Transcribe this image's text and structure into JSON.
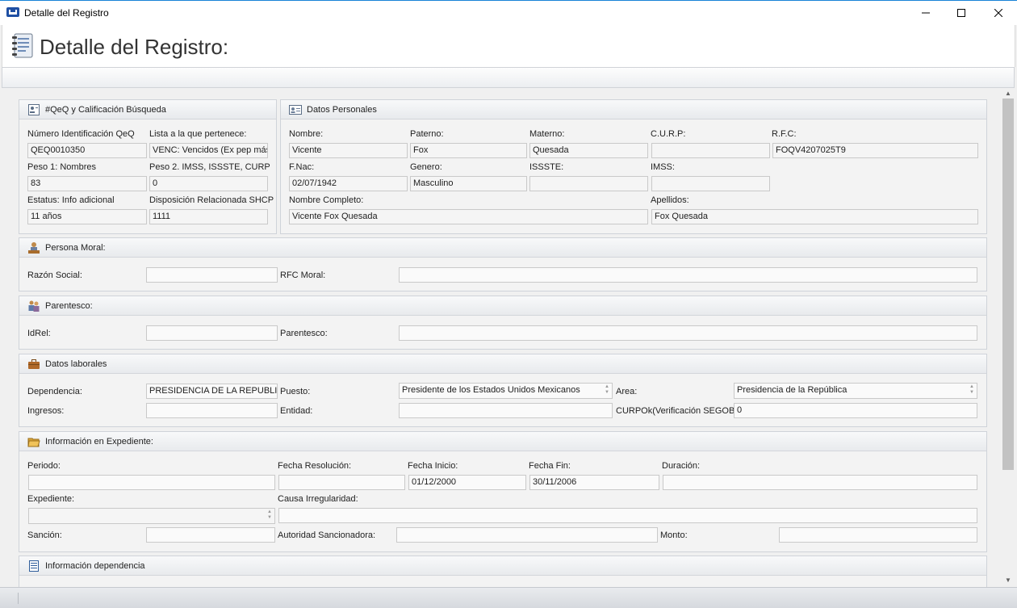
{
  "window": {
    "title": "Detalle del Registro",
    "minimize_icon": "minimize-icon",
    "maximize_icon": "maximize-icon",
    "close_icon": "close-icon"
  },
  "header": {
    "title": "Detalle del Registro:",
    "icon": "notebook-icon"
  },
  "qeq": {
    "title": "#QeQ y Calificación Búsqueda",
    "numero_label": "Número Identificación QeQ",
    "numero": "QEQ0010350",
    "lista_label": "Lista a la que pertenece:",
    "lista": "VENC: Vencidos (Ex pep más",
    "peso1_label": "Peso 1: Nombres",
    "peso1": "83",
    "peso2_label": "Peso 2. IMSS, ISSSTE, CURP",
    "peso2": "0",
    "estatus_label": "Estatus: Info adicional",
    "estatus": "11 años",
    "disposicion_label": "Disposición Relacionada SHCP",
    "disposicion": "1111"
  },
  "personales": {
    "title": "Datos Personales",
    "nombre_label": "Nombre:",
    "nombre": "Vicente",
    "paterno_label": "Paterno:",
    "paterno": "Fox",
    "materno_label": "Materno:",
    "materno": "Quesada",
    "curp_label": "C.U.R.P:",
    "curp": "",
    "rfc_label": "R.F.C:",
    "rfc": "FOQV4207025T9",
    "fnac_label": "F.Nac:",
    "fnac": "02/07/1942",
    "genero_label": "Genero:",
    "genero": "Masculino",
    "issste_label": "ISSSTE:",
    "issste": "",
    "imss_label": "IMSS:",
    "imss": "",
    "completo_label": "Nombre Completo:",
    "completo": "Vicente Fox Quesada",
    "apellidos_label": "Apellidos:",
    "apellidos": "Fox Quesada"
  },
  "moral": {
    "title": "Persona Moral:",
    "razon_label": "Razón Social:",
    "razon": "",
    "rfc_label": "RFC Moral:",
    "rfc": ""
  },
  "parentesco": {
    "title": "Parentesco:",
    "idrel_label": "IdRel:",
    "idrel": "",
    "par_label": "Parentesco:",
    "par": ""
  },
  "laborales": {
    "title": "Datos laborales",
    "dependencia_label": "Dependencia:",
    "dependencia": "PRESIDENCIA DE LA REPUBLICA",
    "puesto_label": "Puesto:",
    "puesto": "Presidente de los Estados Unidos Mexicanos",
    "area_label": "Area:",
    "area": "Presidencia de la República",
    "ingresos_label": "Ingresos:",
    "ingresos": "",
    "entidad_label": "Entidad:",
    "entidad": "",
    "curpok_label": "CURPOk(Verificación SEGOB):",
    "curpok": "0"
  },
  "expediente": {
    "title": "Información en Expediente:",
    "periodo_label": "Periodo:",
    "periodo": "",
    "fres_label": "Fecha Resolución:",
    "fres": "",
    "finicio_label": "Fecha Inicio:",
    "finicio": "01/12/2000",
    "ffin_label": "Fecha Fin:",
    "ffin": "30/11/2006",
    "duracion_label": "Duración:",
    "duracion": "",
    "expediente_label": "Expediente:",
    "expediente": "",
    "causa_label": "Causa Irregularidad:",
    "causa": "",
    "sancion_label": "Sanción:",
    "sancion": "",
    "autoridad_label": "Autoridad Sancionadora:",
    "autoridad": "",
    "monto_label": "Monto:",
    "monto": ""
  },
  "dependencia": {
    "title": "Información dependencia"
  }
}
